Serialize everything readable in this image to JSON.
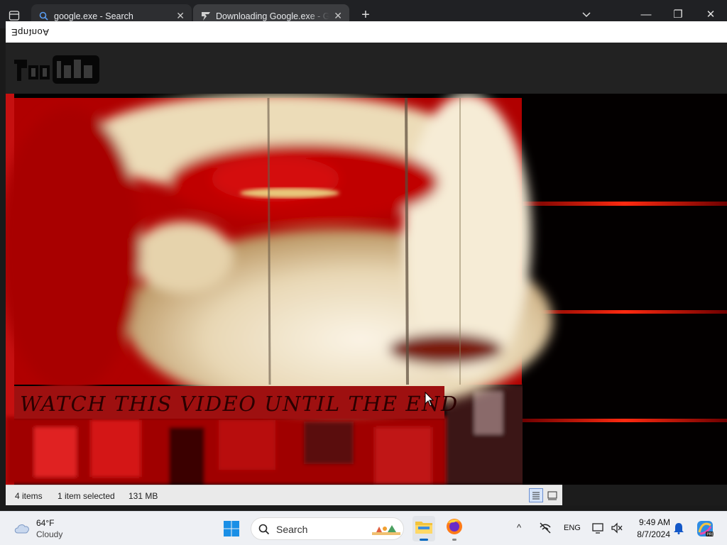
{
  "browser": {
    "tabs": [
      {
        "title": "google.exe - Search",
        "close": "✕"
      },
      {
        "title": "Downloading Google.exe - Gar",
        "close": "✕"
      }
    ],
    "new_tab": "+",
    "window_controls": {
      "minimize": "—",
      "maximize": "❐",
      "close": "✕"
    }
  },
  "media_window": {
    "title": "ƎqnʇnoA",
    "video_banner": "WATCH THIS VIDEO UNTIL THE END"
  },
  "explorer_status": {
    "item_count": "4 items",
    "selection": "1 item selected",
    "size": "131 MB"
  },
  "taskbar": {
    "weather": {
      "temp": "64°F",
      "condition": "Cloudy"
    },
    "search_label": "Search",
    "tray": {
      "chevron": "^",
      "language": "ENG"
    },
    "clock": {
      "time": "9:49 AM",
      "date": "8/7/2024"
    }
  },
  "colors": {
    "accent": "#0067c0",
    "banner": "#9e1010",
    "video_red": "#b00000"
  }
}
